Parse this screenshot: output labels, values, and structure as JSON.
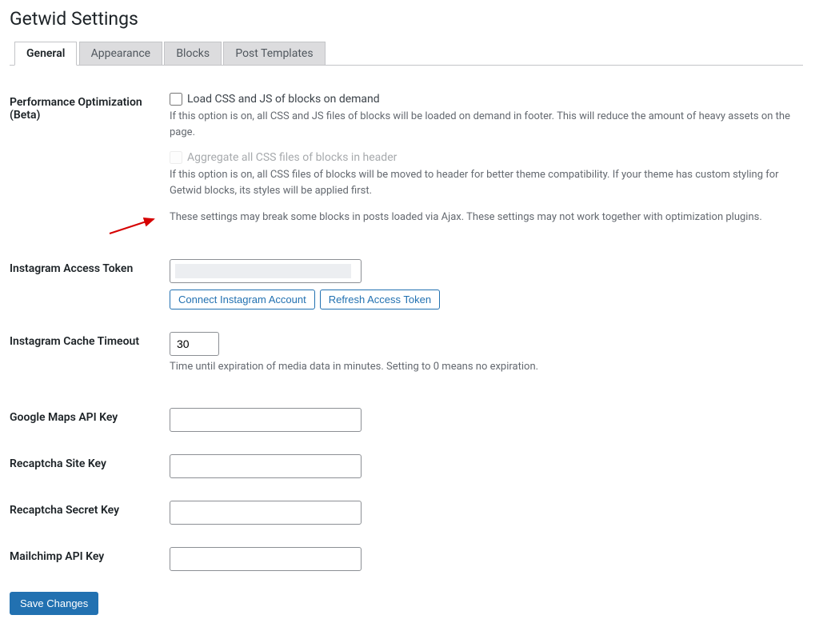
{
  "pageTitle": "Getwid Settings",
  "tabs": {
    "general": "General",
    "appearance": "Appearance",
    "blocks": "Blocks",
    "postTemplates": "Post Templates"
  },
  "fields": {
    "perfOpt": {
      "label": "Performance Optimization (Beta)",
      "check1Label": "Load CSS and JS of blocks on demand",
      "check1Desc": "If this option is on, all CSS and JS files of blocks will be loaded on demand in footer. This will reduce the amount of heavy assets on the page.",
      "check2Label": "Aggregate all CSS files of blocks in header",
      "check2Desc": "If this option is on, all CSS files of blocks will be moved to header for better theme compatibility. If your theme has custom styling for Getwid blocks, its styles will be applied first.",
      "warning": "These settings may break some blocks in posts loaded via Ajax. These settings may not work together with optimization plugins."
    },
    "instaToken": {
      "label": "Instagram Access Token",
      "connectBtn": "Connect Instagram Account",
      "refreshBtn": "Refresh Access Token"
    },
    "instaCache": {
      "label": "Instagram Cache Timeout",
      "value": "30",
      "desc": "Time until expiration of media data in minutes. Setting to 0 means no expiration."
    },
    "gmaps": {
      "label": "Google Maps API Key",
      "value": ""
    },
    "recapSite": {
      "label": "Recaptcha Site Key",
      "value": ""
    },
    "recapSecret": {
      "label": "Recaptcha Secret Key",
      "value": ""
    },
    "mailchimp": {
      "label": "Mailchimp API Key",
      "value": ""
    }
  },
  "saveBtn": "Save Changes"
}
